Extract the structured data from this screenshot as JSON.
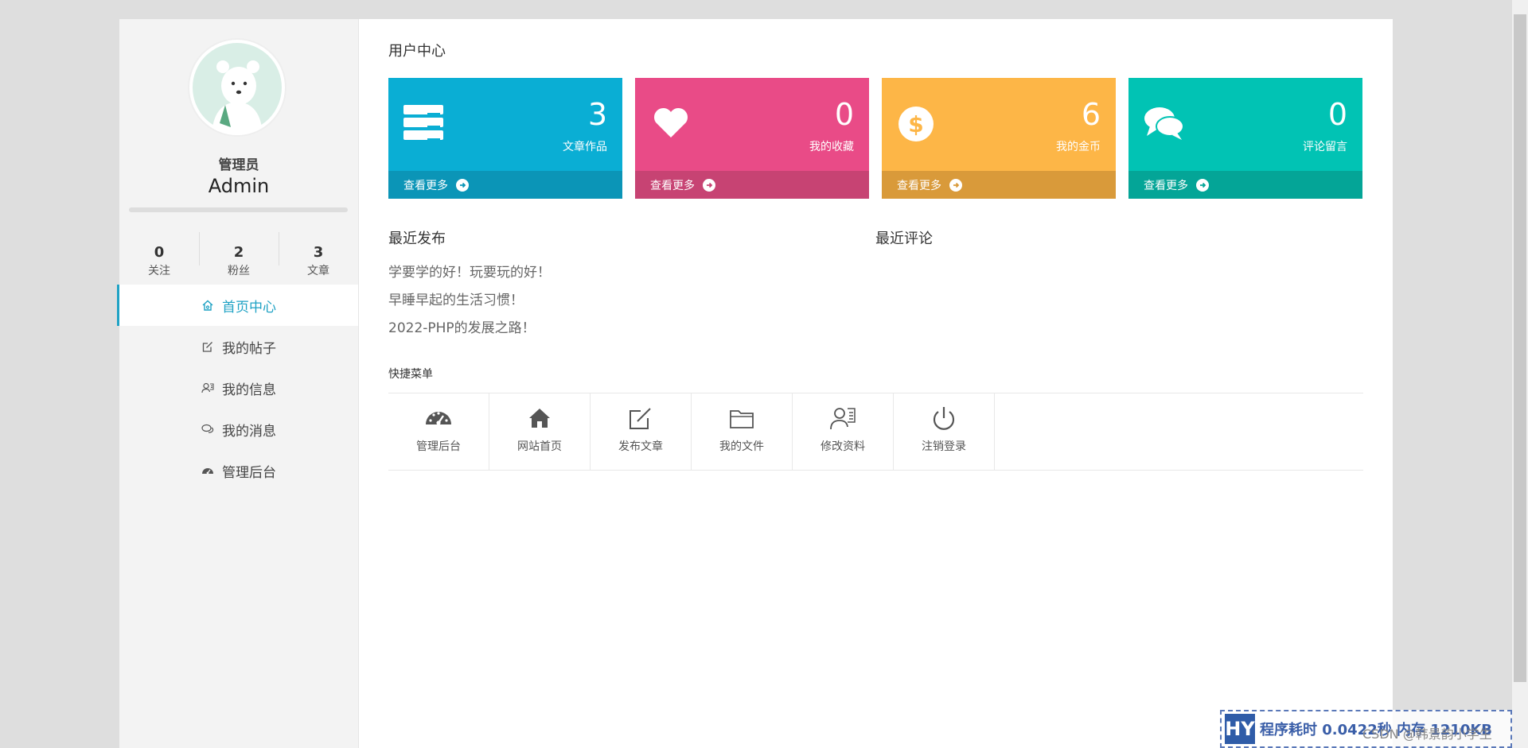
{
  "user": {
    "role": "管理员",
    "name": "Admin"
  },
  "stats": [
    {
      "num": "0",
      "label": "关注"
    },
    {
      "num": "2",
      "label": "粉丝"
    },
    {
      "num": "3",
      "label": "文章"
    }
  ],
  "nav": [
    {
      "label": "首页中心",
      "icon": "home-icon"
    },
    {
      "label": "我的帖子",
      "icon": "edit-icon"
    },
    {
      "label": "我的信息",
      "icon": "user-card-icon"
    },
    {
      "label": "我的消息",
      "icon": "chat-icon"
    },
    {
      "label": "管理后台",
      "icon": "dashboard-icon"
    }
  ],
  "main": {
    "title": "用户中心"
  },
  "cards": [
    {
      "num": "3",
      "label": "文章作品",
      "more": "查看更多",
      "color": "#0aaed4",
      "footer_color": "#0b95b7",
      "icon": "server-icon"
    },
    {
      "num": "0",
      "label": "我的收藏",
      "more": "查看更多",
      "color": "#e94b87",
      "footer_color": "#c74373",
      "icon": "heart-icon"
    },
    {
      "num": "6",
      "label": "我的金币",
      "more": "查看更多",
      "color": "#fdb647",
      "footer_color": "#d99a3a",
      "icon": "coin-icon"
    },
    {
      "num": "0",
      "label": "评论留言",
      "more": "查看更多",
      "color": "#01c3b4",
      "footer_color": "#04a597",
      "icon": "comments-icon"
    }
  ],
  "recent": {
    "posts_title": "最近发布",
    "comments_title": "最近评论",
    "posts": [
      "学要学的好！玩要玩的好！",
      "早睡早起的生活习惯！",
      "2022-PHP的发展之路！"
    ]
  },
  "quick": {
    "title": "快捷菜单",
    "items": [
      {
        "label": "管理后台",
        "icon": "dashboard-icon"
      },
      {
        "label": "网站首页",
        "icon": "home-icon"
      },
      {
        "label": "发布文章",
        "icon": "edit-icon"
      },
      {
        "label": "我的文件",
        "icon": "folder-icon"
      },
      {
        "label": "修改资料",
        "icon": "user-card-icon"
      },
      {
        "label": "注销登录",
        "icon": "power-icon"
      }
    ]
  },
  "watermark": {
    "logo": "HY",
    "text": "程序耗时 0.0422秒 内存 1210KB",
    "csdn": "CSDN @韩景韵小学生"
  }
}
